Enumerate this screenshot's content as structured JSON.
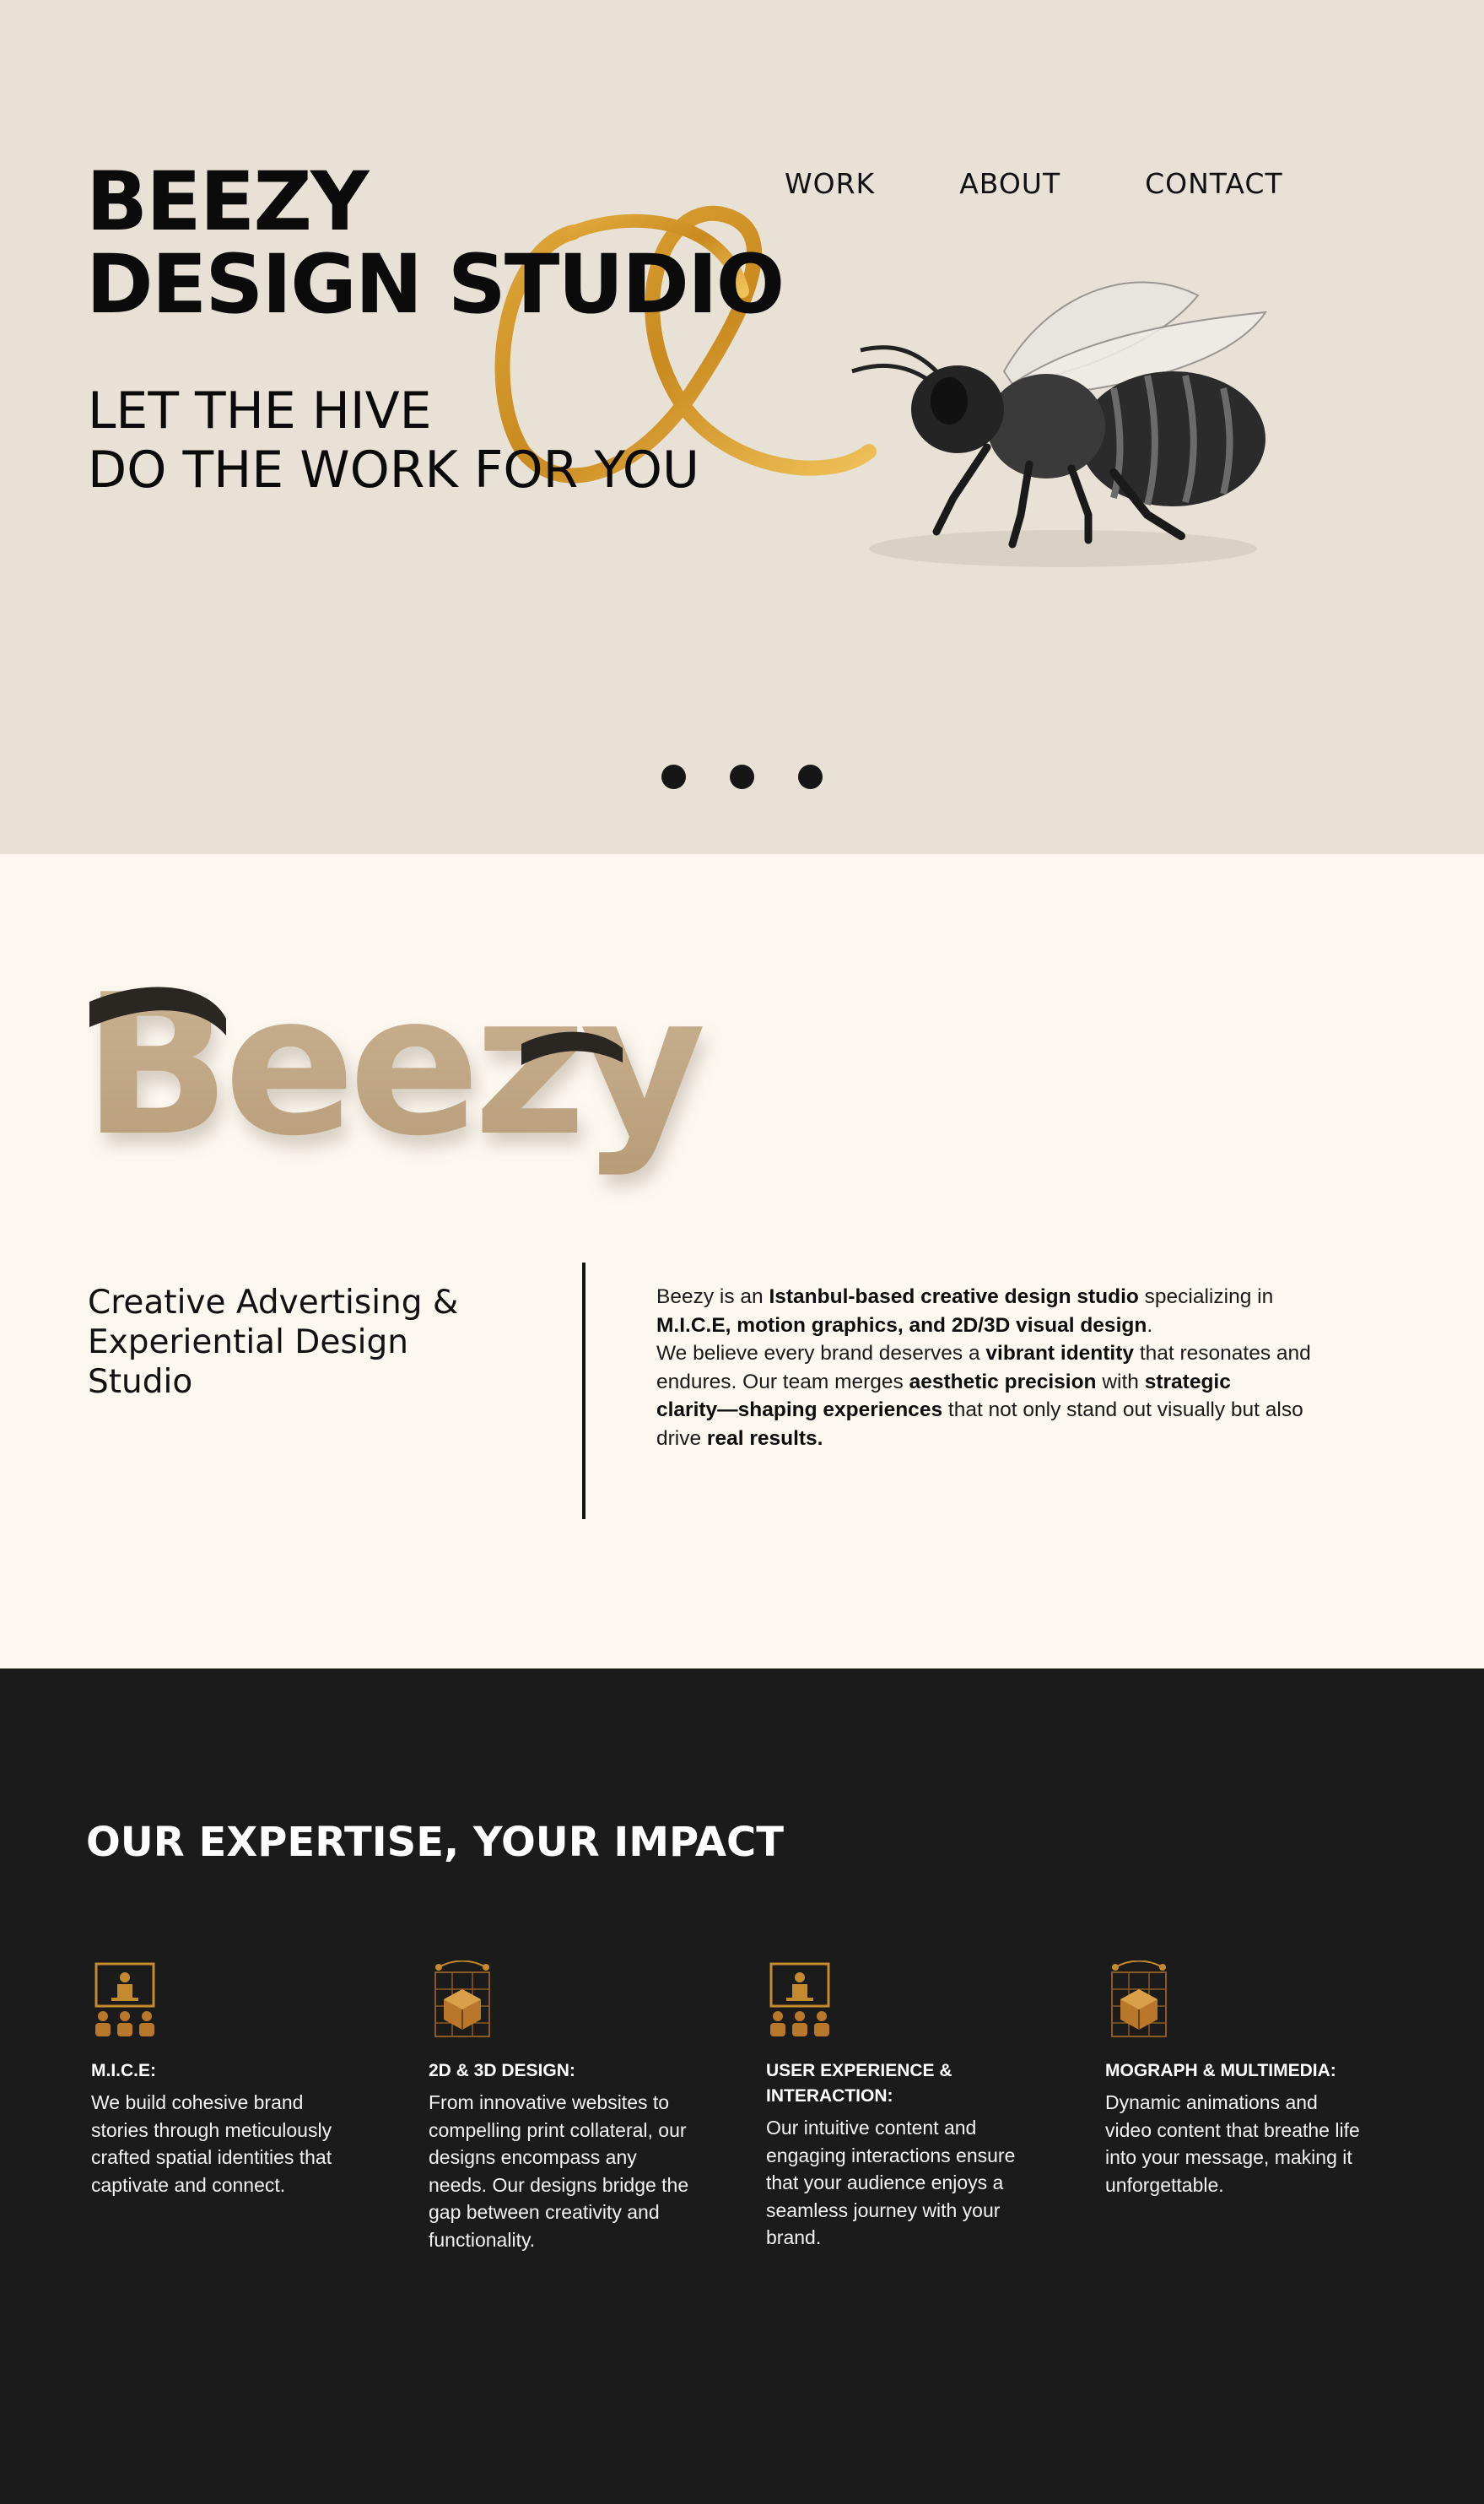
{
  "colors": {
    "hero_bg": "#e7e1d6",
    "about_bg": "#fcf8f0",
    "expertise_bg": "#1b1b1b",
    "gold": "#c8902a",
    "text_dark": "#0b0b0b"
  },
  "hero": {
    "title_lines": [
      "BEEZY",
      "DESIGN STUDIO"
    ],
    "tagline_lines": [
      "LET THE HIVE",
      "DO THE WORK FOR YOU"
    ],
    "nav": [
      "WORK",
      "ABOUT",
      "CONTACT"
    ],
    "images": [
      "gold-loop-ornament",
      "bee-illustration"
    ],
    "carousel_dots": 3
  },
  "about": {
    "wordmark": "Beezy",
    "heading_lines": [
      "Creative Advertising &",
      "Experiential Design",
      "Studio"
    ],
    "paragraph": {
      "l1_a": "Beezy is an ",
      "l1_b": "Istanbul-based creative design studio",
      "l1_c": " specializing in",
      "l2_a": "M.I.C.E, motion graphics, and 2D/3D visual design",
      "l2_b": ".",
      "l3_a": "We believe every brand deserves a ",
      "l3_b": "vibrant identity",
      "l3_c": " that resonates and",
      "l4_a": "endures. Our team merges ",
      "l4_b": "aesthetic precision",
      "l4_c": " with ",
      "l4_d": "strategic",
      "l5_a": "clarity—shaping experiences",
      "l5_b": " that not only stand out visually but also",
      "l6_a": "drive ",
      "l6_b": "real results."
    }
  },
  "expertise": {
    "title": "OUR EXPERTISE, YOUR IMPACT",
    "cards": [
      {
        "icon": "presentation-audience-icon",
        "title_lines": [
          "M.I.C.E:"
        ],
        "body_lines": [
          "We build cohesive brand",
          "stories through meticulously",
          "crafted spatial identities that",
          "captivate and connect."
        ]
      },
      {
        "icon": "3d-cube-design-icon",
        "title_lines": [
          "2D & 3D DESIGN:"
        ],
        "body_lines": [
          "From innovative websites to",
          "compelling print collateral, our",
          "designs encompass any",
          "needs. Our designs bridge the",
          "gap between creativity and",
          "functionality."
        ]
      },
      {
        "icon": "presentation-audience-icon",
        "title_lines": [
          "USER EXPERIENCE &",
          "INTERACTION:"
        ],
        "body_lines": [
          "Our intuitive content and",
          "engaging interactions ensure",
          "that your audience enjoys a",
          "seamless journey with your",
          "brand."
        ]
      },
      {
        "icon": "3d-cube-design-icon",
        "title_lines": [
          "MOGRAPH & MULTIMEDIA:"
        ],
        "body_lines": [
          "Dynamic animations and",
          "video content that breathe life",
          "into your message, making it",
          "unforgettable."
        ]
      }
    ]
  }
}
